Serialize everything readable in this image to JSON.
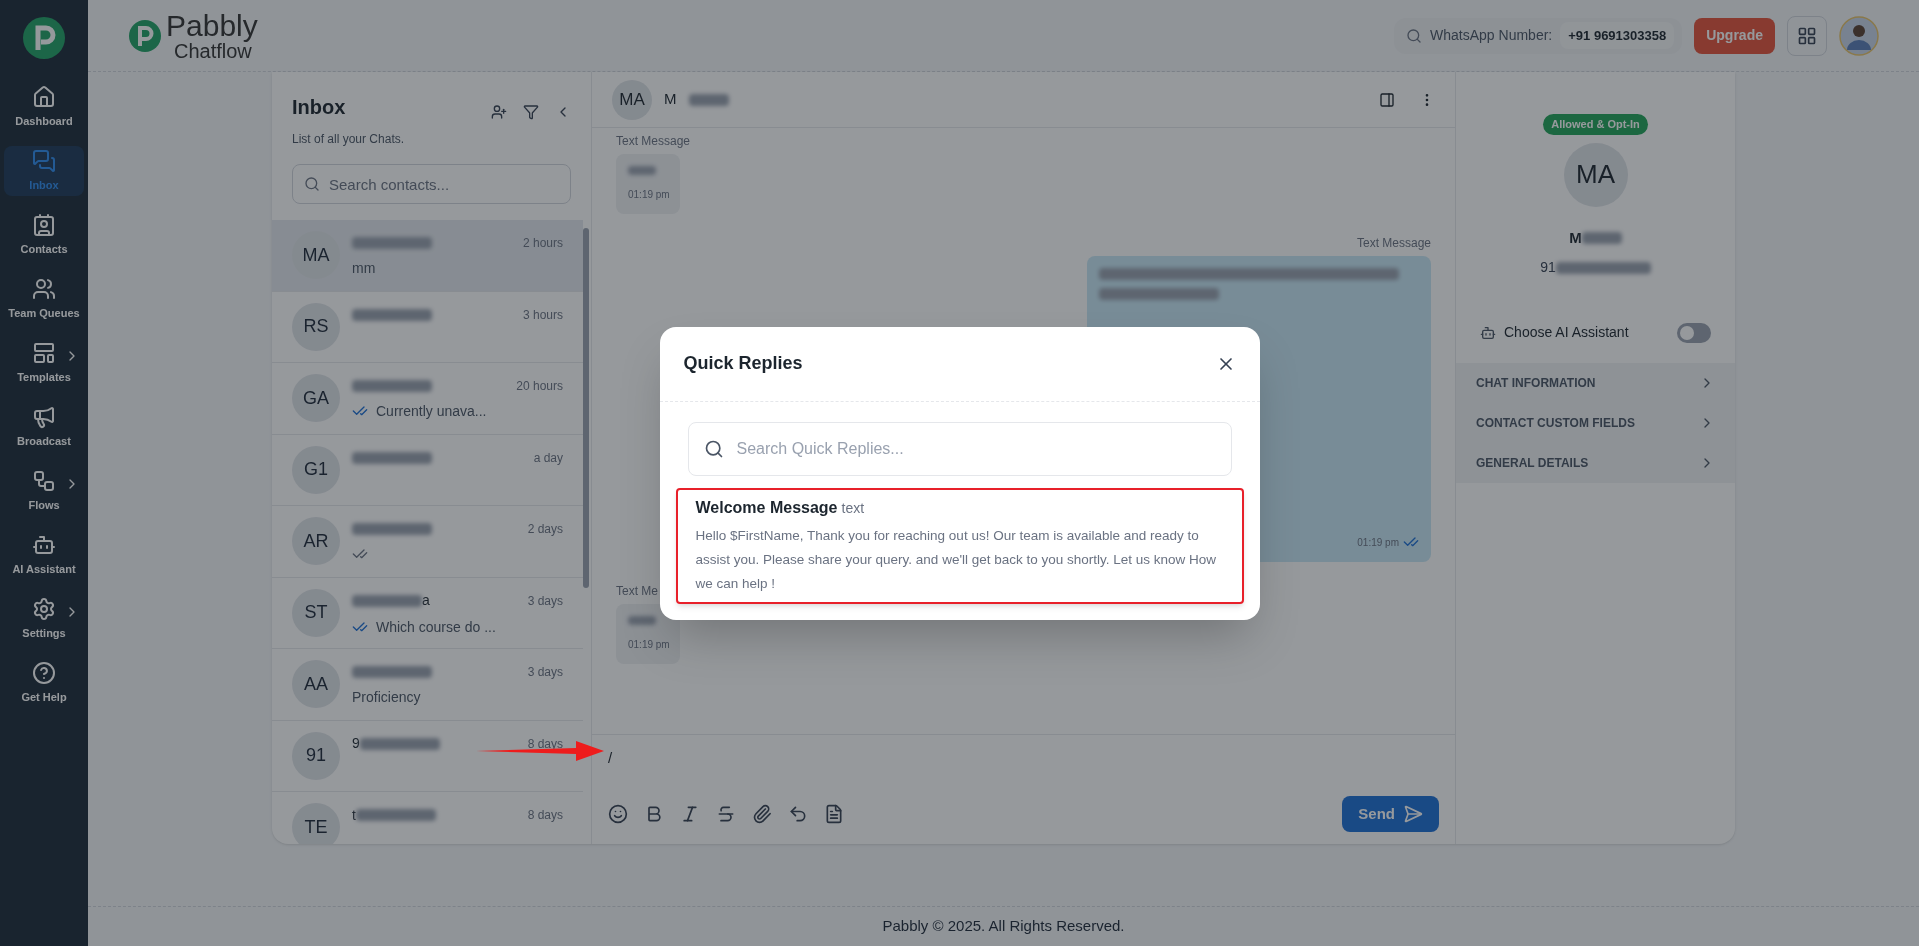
{
  "sidebar": {
    "items": [
      {
        "label": "Dashboard",
        "selected": false,
        "submenu": false
      },
      {
        "label": "Inbox",
        "selected": true,
        "submenu": false
      },
      {
        "label": "Contacts",
        "selected": false,
        "submenu": false
      },
      {
        "label": "Team Queues",
        "selected": false,
        "submenu": false
      },
      {
        "label": "Templates",
        "selected": false,
        "submenu": true
      },
      {
        "label": "Broadcast",
        "selected": false,
        "submenu": false
      },
      {
        "label": "Flows",
        "selected": false,
        "submenu": true
      },
      {
        "label": "AI Assistant",
        "selected": false,
        "submenu": false
      },
      {
        "label": "Settings",
        "selected": false,
        "submenu": true
      },
      {
        "label": "Get Help",
        "selected": false,
        "submenu": false
      }
    ]
  },
  "header": {
    "brand_name": "Pabbly",
    "brand_product": "Chatflow",
    "whatsapp_label": "WhatsApp Number:",
    "whatsapp_number": "+91 9691303358",
    "upgrade": "Upgrade"
  },
  "inbox": {
    "title": "Inbox",
    "subtitle": "List of all your Chats.",
    "search_placeholder": "Search contacts...",
    "chats": [
      {
        "kind": "plain",
        "initials": "MA",
        "time": "2 hours",
        "preview": "mm",
        "selected": true
      },
      {
        "kind": "plain",
        "initials": "RS",
        "time": "3 hours",
        "selected": false
      },
      {
        "kind": "read",
        "initials": "GA",
        "time": "20 hours",
        "preview": "Currently unava...",
        "selected": false
      },
      {
        "kind": "plain",
        "initials": "G1",
        "time": "a day",
        "selected": false
      },
      {
        "kind": "sent",
        "initials": "AR",
        "time": "2 days",
        "selected": false
      },
      {
        "kind": "read",
        "initials": "ST",
        "name_tail": "a",
        "time": "3 days",
        "preview": "Which course do ...",
        "selected": false
      },
      {
        "kind": "plain",
        "initials": "AA",
        "time": "3 days",
        "preview": "Proficiency",
        "selected": false
      },
      {
        "kind": "plain",
        "initials": "91",
        "name": "9",
        "time": "8 days",
        "selected": false
      },
      {
        "kind": "plain",
        "initials": "TE",
        "name": "t",
        "time": "8 days",
        "selected": false
      }
    ]
  },
  "chat": {
    "initials": "MA",
    "name": "M",
    "messages": [
      {
        "kind": "incoming",
        "label": "Text Message",
        "time": "01:19 pm"
      },
      {
        "kind": "outgoing",
        "label": "Text Message",
        "time": "01:19 pm"
      },
      {
        "kind": "incoming",
        "label": "Text Me",
        "time": "01:19 pm"
      }
    ],
    "composer_value": "/",
    "send": "Send"
  },
  "contact_panel": {
    "badge": "Allowed & Opt-In",
    "initials": "MA",
    "name": "M",
    "phone": "91",
    "ai_label": "Choose AI Assistant",
    "ai_on": false,
    "sections": [
      "CHAT INFORMATION",
      "CONTACT CUSTOM FIELDS",
      "GENERAL DETAILS"
    ]
  },
  "modal": {
    "title": "Quick Replies",
    "search_placeholder": "Search Quick Replies...",
    "replies": [
      {
        "title": "Welcome Message",
        "type": "text",
        "body": "Hello $FirstName, Thank you for reaching out us! Our team is available and ready to assist you. Please share your query. and we'll get back to you shortly. Let us know How we can help !",
        "highlighted": true
      }
    ]
  },
  "footer": "Pabbly © 2025. All Rights Reserved."
}
